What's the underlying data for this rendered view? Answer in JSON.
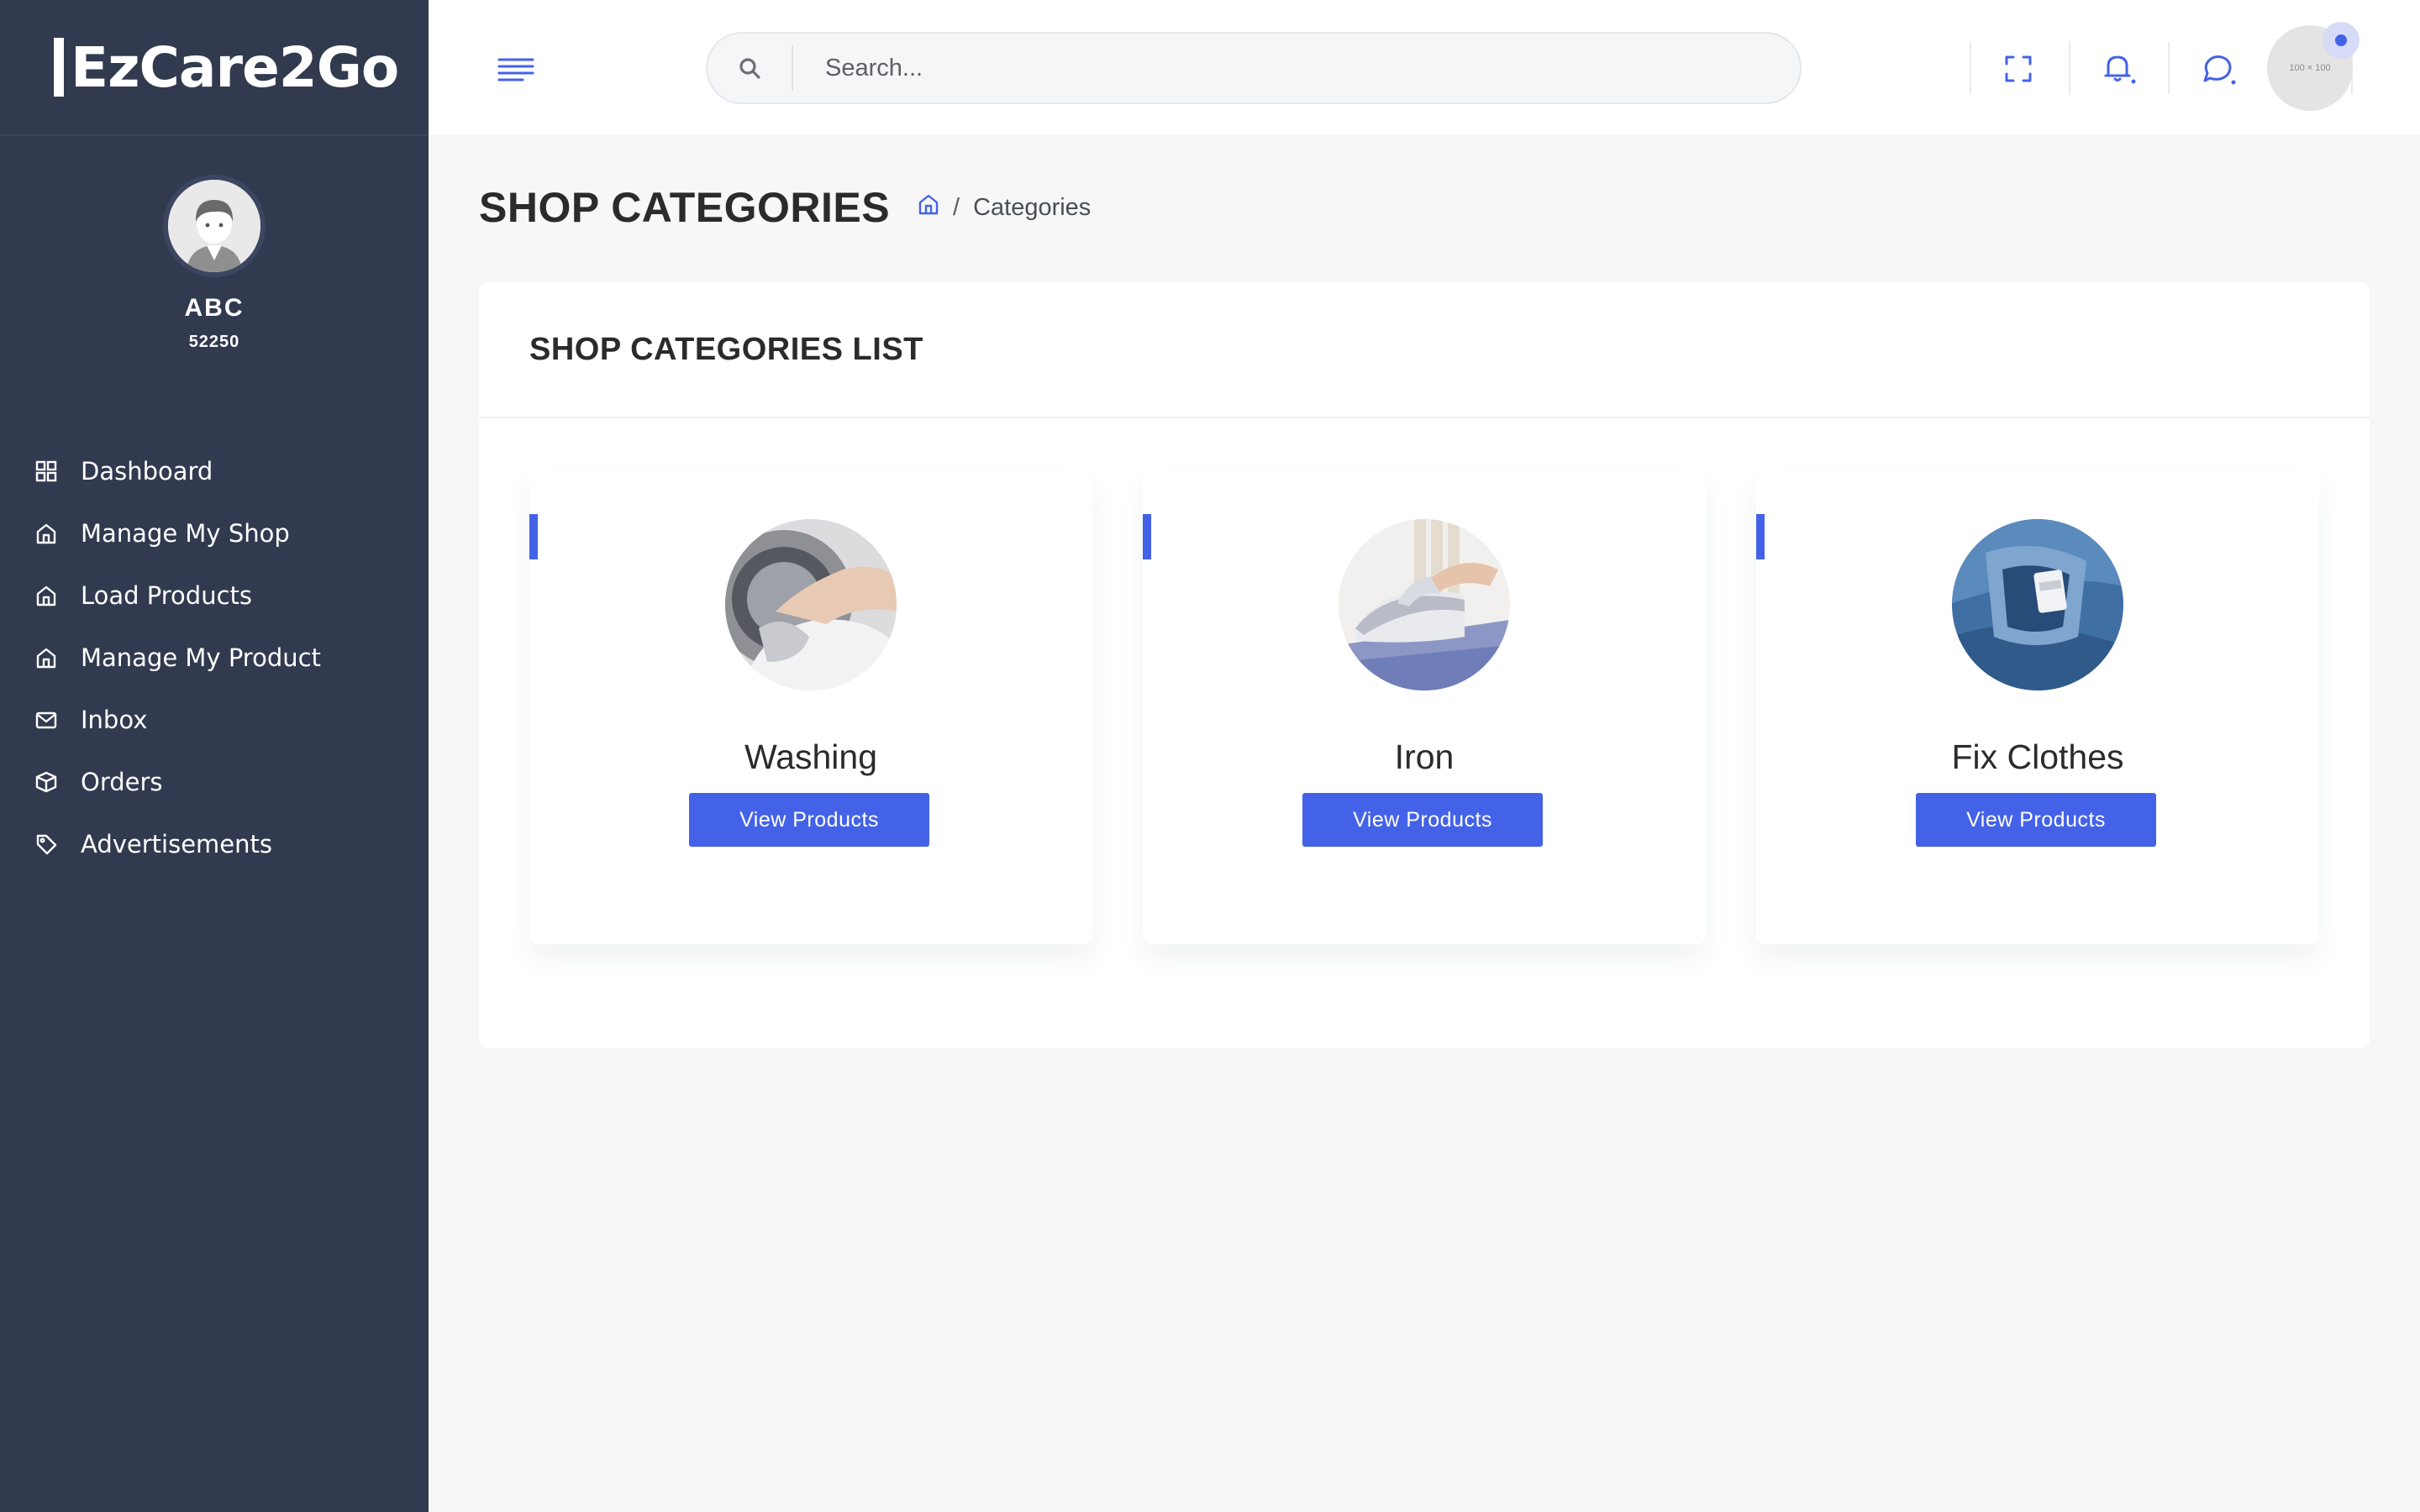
{
  "brand": {
    "name": "EzCare2Go"
  },
  "profile": {
    "name": "ABC",
    "id": "52250"
  },
  "sidebar": {
    "items": [
      {
        "label": "Dashboard",
        "icon": "grid-icon"
      },
      {
        "label": "Manage My Shop",
        "icon": "home-icon"
      },
      {
        "label": "Load Products",
        "icon": "home-icon"
      },
      {
        "label": "Manage My Product",
        "icon": "home-icon"
      },
      {
        "label": "Inbox",
        "icon": "mail-icon"
      },
      {
        "label": "Orders",
        "icon": "box-icon"
      },
      {
        "label": "Advertisements",
        "icon": "tag-icon"
      }
    ]
  },
  "header": {
    "search_placeholder": "Search...",
    "avatar_text": "100 × 100"
  },
  "page": {
    "title": "SHOP CATEGORIES",
    "breadcrumb_sep": "/",
    "breadcrumb_current": "Categories"
  },
  "card": {
    "title": "SHOP CATEGORIES LIST",
    "categories": [
      {
        "name": "Washing",
        "button": "View Products"
      },
      {
        "name": "Iron",
        "button": "View Products"
      },
      {
        "name": "Fix Clothes",
        "button": "View Products"
      }
    ]
  },
  "colors": {
    "sidebar_bg": "#313a4f",
    "accent": "#4462e8",
    "page_bg": "#f7f7f8"
  }
}
